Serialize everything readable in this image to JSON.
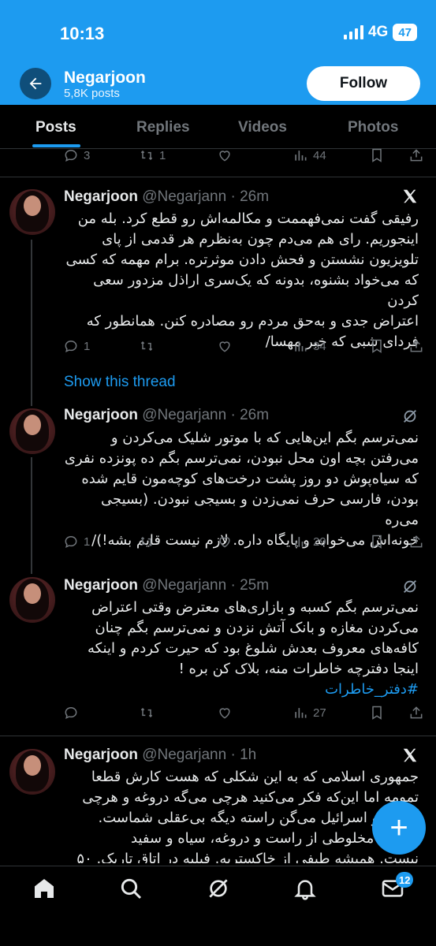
{
  "status_bar": {
    "time": "10:13",
    "network": "4G",
    "battery": "47"
  },
  "profile": {
    "name": "Negarjoon",
    "posts_count": "5,8K posts",
    "follow_label": "Follow"
  },
  "tabs": [
    {
      "label": "Posts"
    },
    {
      "label": "Replies"
    },
    {
      "label": "Videos"
    },
    {
      "label": "Photos"
    }
  ],
  "top_partial": {
    "replies": "3",
    "reposts": "1",
    "likes": "",
    "views": "44"
  },
  "tweets": [
    {
      "name": "Negarjoon",
      "handle": "@Negarjann",
      "time": "· 26m",
      "source_icon": "x-logo-icon",
      "lines": [
        "رفیقی گفت نمی‌فهممت و مکالمه‌اش رو قطع کرد. بله من",
        "اینجوریم. رای هم می‌دم چون به‌نظرم هر قدمی از پای",
        "تلویزیون نشستن و فحش دادن موثرتره. برام مهمه که کسی",
        "که می‌خواد بشنوه، بدونه که یک‌سری اراذل مزدور سعی کردن",
        "اعتراض جدی و به‌حق مردم رو مصادره کنن. همانطور که",
        "فردای شبی که خبر مهسا/"
      ],
      "hashtag": "",
      "replies": "1",
      "reposts": "",
      "likes": "",
      "views": "34"
    },
    {
      "name": "Negarjoon",
      "handle": "@Negarjann",
      "time": "· 26m",
      "source_icon": "slashed-circle-icon",
      "lines": [
        "نمی‌ترسم بگم این‌هایی که با موتور شلیک می‌کردن و",
        "می‌رفتن بچه اون محل نبودن، نمی‌ترسم بگم ده پونزده نفری",
        "که سیاه‌پوش دو روز پشت درخت‌های کوچه‌مون قایم شده",
        "بودن، فارسی حرف نمی‌زدن و بسیجی نبودن. (بسیجی می‌ره",
        "خونه‌اش می‌خوابه و پایگاه داره. لازم نیست قایم بشه!)/"
      ],
      "hashtag": "",
      "replies": "1",
      "reposts": "",
      "likes": "",
      "views": "29"
    },
    {
      "name": "Negarjoon",
      "handle": "@Negarjann",
      "time": "· 25m",
      "source_icon": "slashed-circle-icon",
      "lines": [
        "نمی‌ترسم بگم کسبه و بازاری‌های معترض وقتی اعتراض",
        "می‌کردن مغازه و بانک آتش نزدن و نمی‌ترسم بگم چنان",
        "کافه‌های معروف بعدش شلوغ بود که حیرت کردم و اینکه",
        "اینجا دفترچه خاطرات منه، بلاک کن بره !"
      ],
      "hashtag": "#دفتر_خاطرات",
      "replies": "",
      "reposts": "",
      "likes": "",
      "views": "27"
    },
    {
      "name": "Negarjoon",
      "handle": "@Negarjann",
      "time": "· 1h",
      "source_icon": "x-logo-icon",
      "lines": [
        "جمهوری اسلامی که به این شکلی که هست کارش قطعا",
        "تمومه اما این‌که فکر می‌کنید هرچی می‌گه دروغه و هرچی",
        "آمریکا و اسرائیل می‌گن راسته دیگه بی‌عقلی شماست.",
        "همیشه مخلوطی از راست و دروغه، سیاه و سفید",
        "نیست. همیشه طیفی از خاکستریه. فیلیه در اتاق تاریک. ۵۰"
      ],
      "hashtag": "",
      "replies": "",
      "reposts": "",
      "likes": "",
      "views": ""
    }
  ],
  "show_thread_label": "Show this thread",
  "fab_label": "+",
  "bottom_nav": {
    "messages_badge": "12"
  }
}
